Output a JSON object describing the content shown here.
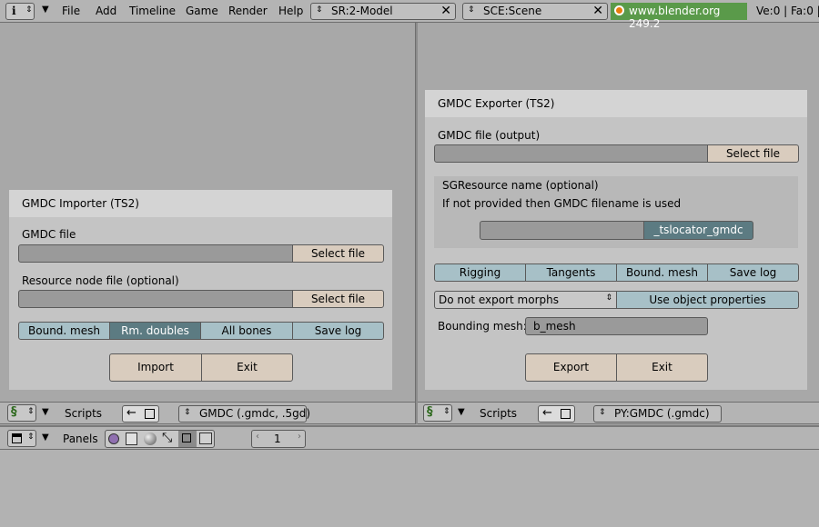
{
  "top": {
    "menus": [
      "File",
      "Add",
      "Timeline",
      "Game",
      "Render",
      "Help"
    ],
    "screen_field": "SR:2-Model",
    "scene_field": "SCE:Scene",
    "blender_label": "www.blender.org 249.2",
    "stats": "Ve:0 | Fa:0 |"
  },
  "importer": {
    "title": "GMDC Importer (TS2)",
    "gmdc_label": "GMDC file",
    "gmdc_value": "",
    "select1": "Select file",
    "resource_label": "Resource node file (optional)",
    "resource_value": "",
    "select2": "Select file",
    "toggles": [
      "Bound. mesh",
      "Rm. doubles",
      "All bones",
      "Save log"
    ],
    "import_btn": "Import",
    "exit_btn": "Exit"
  },
  "exporter": {
    "title": "GMDC Exporter (TS2)",
    "file_label": "GMDC file (output)",
    "file_value": "",
    "select": "Select file",
    "sg_label": "SGResource name (optional)",
    "sg_note": "If not provided then GMDC filename is used",
    "sg_value": "",
    "sg_button": "_tslocator_gmdc",
    "toggles": [
      "Rigging",
      "Tangents",
      "Bound. mesh",
      "Save log"
    ],
    "morph_select": "Do not export morphs",
    "use_obj": "Use object properties",
    "bounding_label": "Bounding mesh:",
    "bounding_value": "b_mesh",
    "export_btn": "Export",
    "exit_btn": "Exit"
  },
  "left_header": {
    "scripts": "Scripts",
    "script_name": "GMDC (.gmdc, .5gd)"
  },
  "right_header": {
    "scripts": "Scripts",
    "script_name": "PY:GMDC (.gmdc)"
  },
  "bottom_header": {
    "panels": "Panels",
    "page_num": "1"
  },
  "colors": {
    "background": "#a8a8a8",
    "panel": "#c4c4c4",
    "blue_button": "#a7c0c7",
    "blue_active": "#5c7b82",
    "tan_button": "#d9ccbe",
    "blender_green": "#5a9a4a"
  }
}
